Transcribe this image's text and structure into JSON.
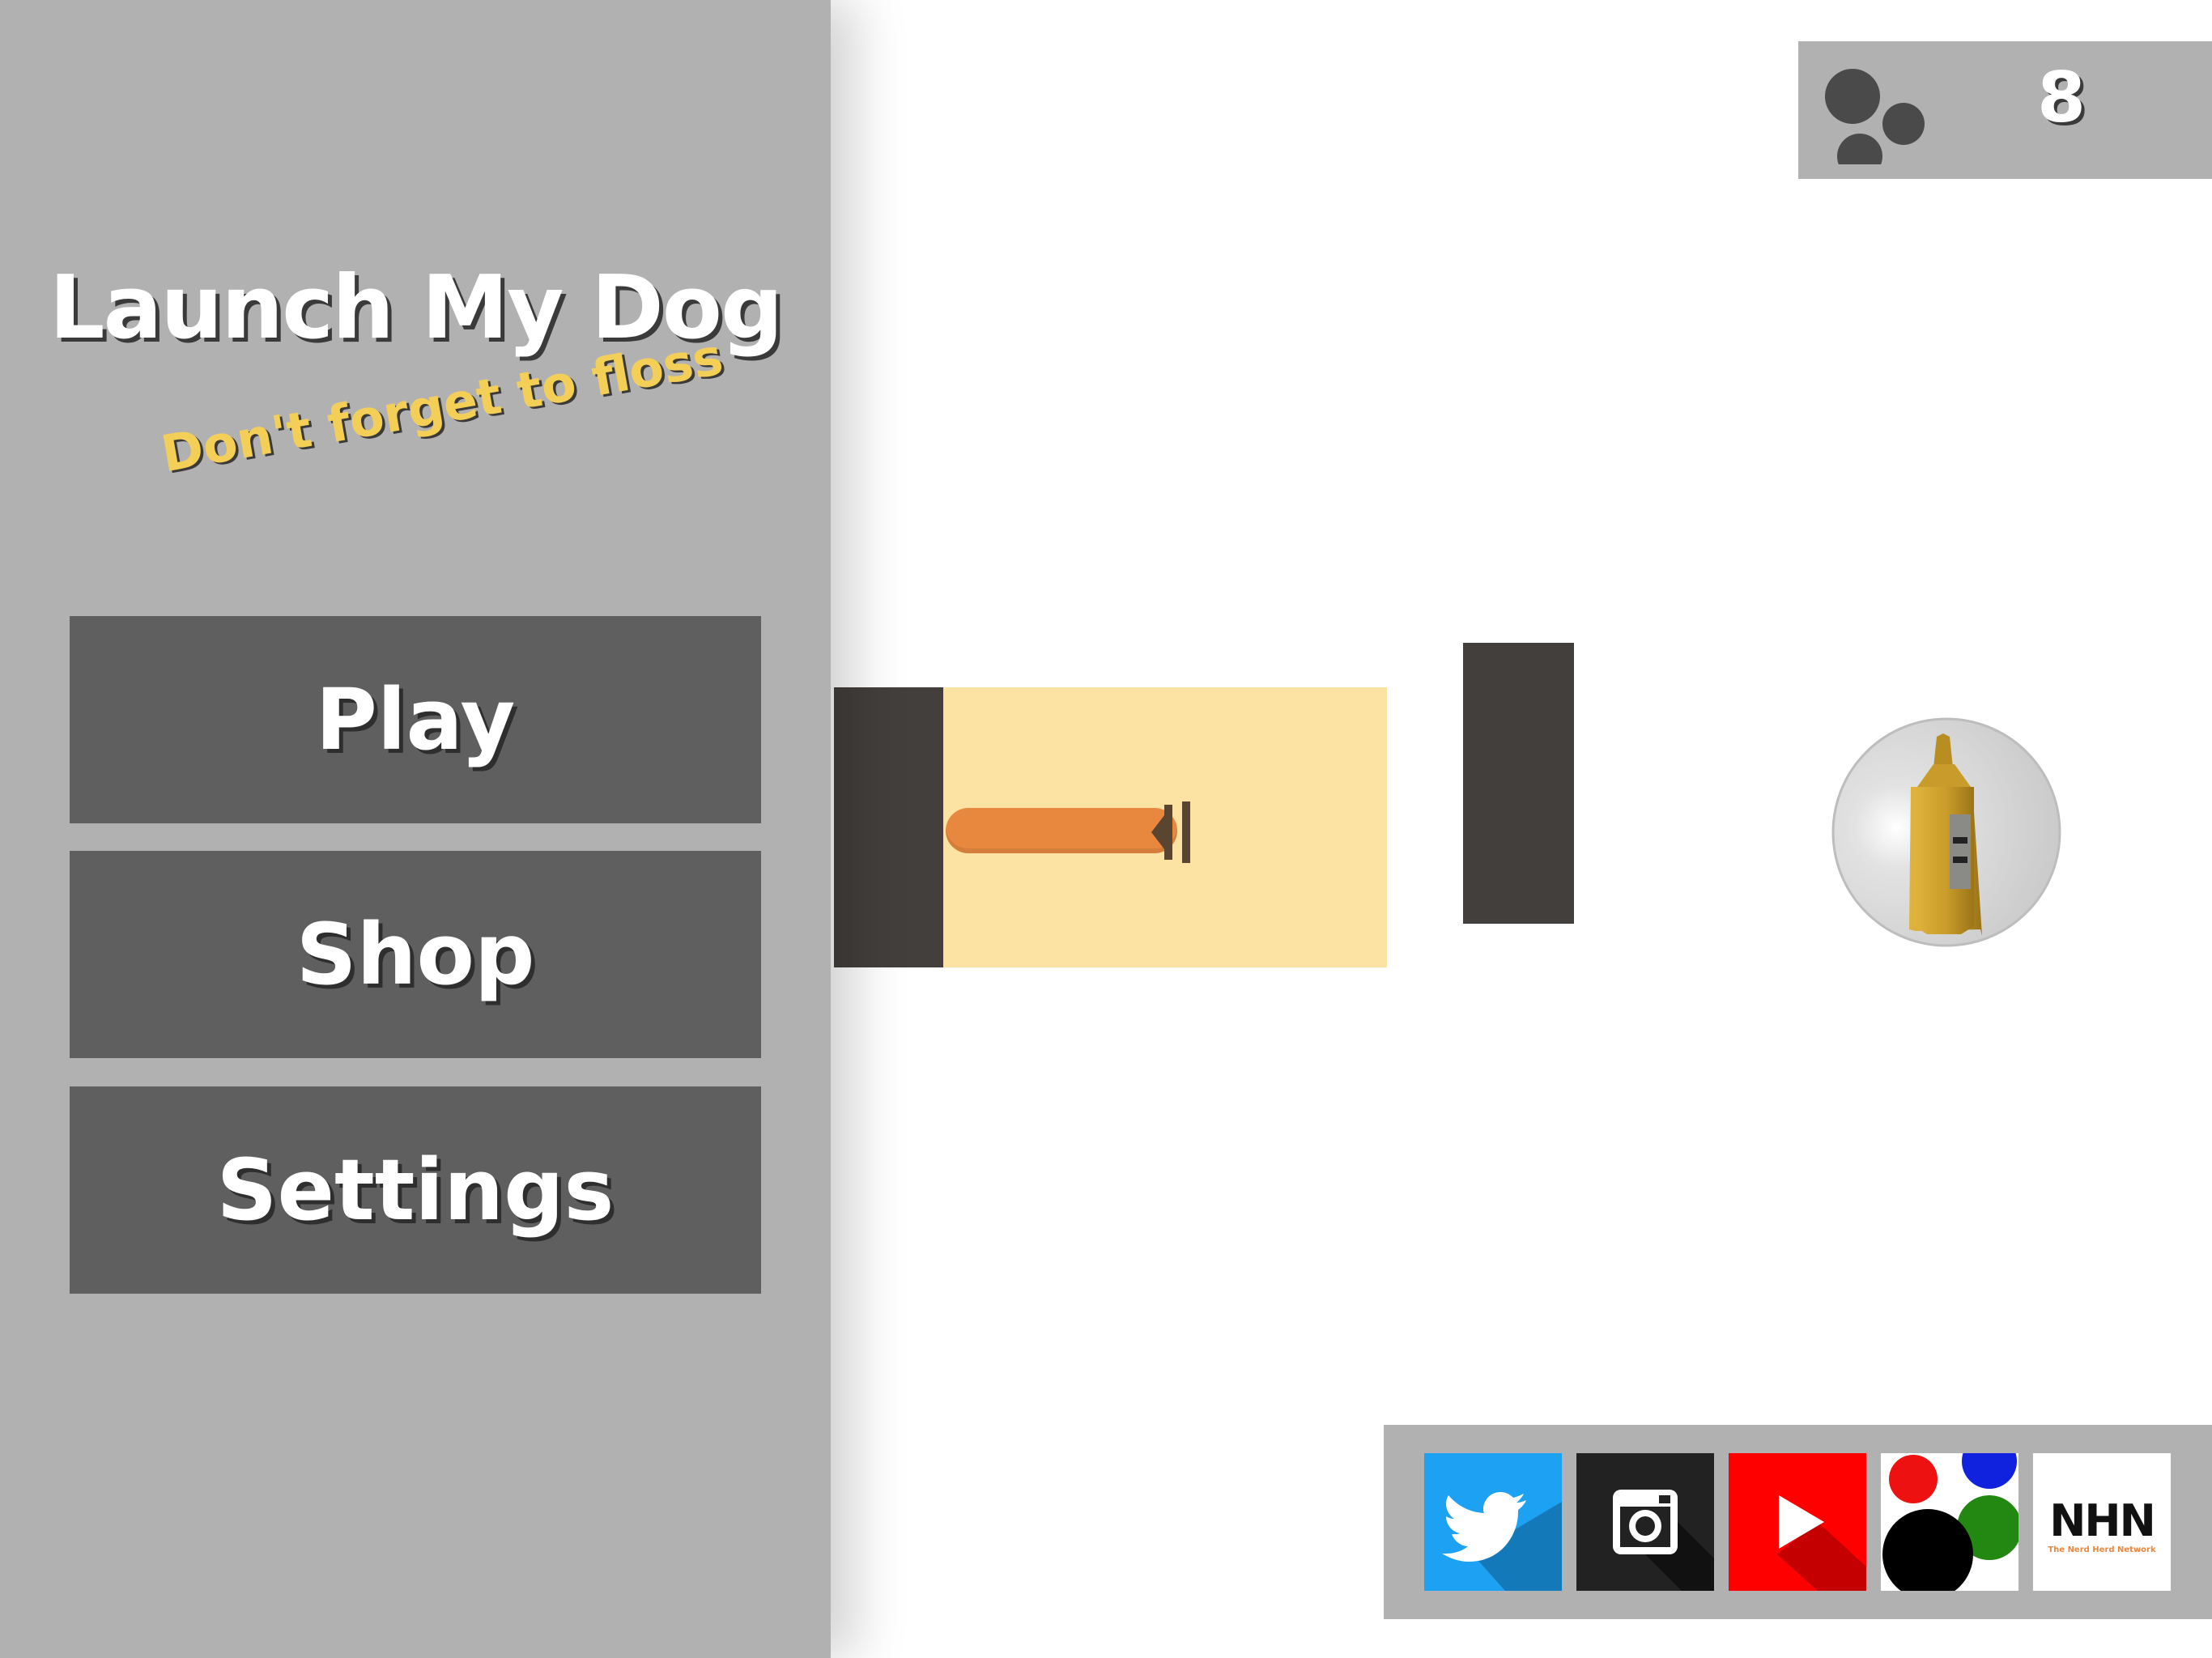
{
  "app": {
    "title": "Launch My Dog",
    "tagline": "Don't forget to floss"
  },
  "menu": {
    "play_label": "Play",
    "shop_label": "Shop",
    "settings_label": "Settings"
  },
  "score": {
    "coins_icon": "coins-icon",
    "value": "8"
  },
  "scene": {
    "launcher_icon": "hotdog-launcher",
    "target_icon": "mustard-bottle-in-bubble",
    "obstacle_icon": "wall-block"
  },
  "social": {
    "items": [
      {
        "name": "twitter",
        "icon": "twitter-bird-icon",
        "color": "#1da1f2"
      },
      {
        "name": "instagram",
        "icon": "camera-icon",
        "color": "#222222"
      },
      {
        "name": "youtube",
        "icon": "play-icon",
        "color": "#ff0000"
      },
      {
        "name": "games",
        "icon": "colored-dots-icon",
        "color": "#ffffff"
      },
      {
        "name": "nhn",
        "icon": "nhn-logo",
        "color": "#ffffff"
      }
    ],
    "nhn_logo_text": "NHN",
    "nhn_logo_subtext": "The Nerd Herd Network"
  },
  "colors": {
    "panel": "#b1b1b1",
    "button": "#5f5f5f",
    "tagline": "#f4cf58",
    "launcher_zone": "#fde3a3",
    "block": "#423f3c",
    "hotdog": "#e8883f",
    "mustard": "#c89b2a"
  }
}
